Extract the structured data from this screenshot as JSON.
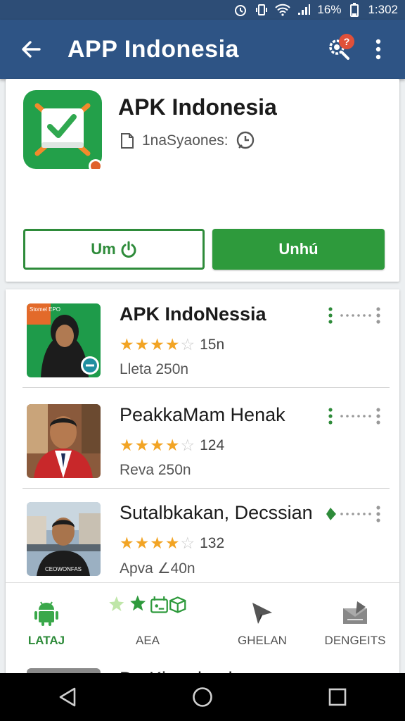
{
  "status_bar": {
    "battery_percent": "16%",
    "time": "1:302"
  },
  "app_bar": {
    "title": "APP Indonesia",
    "badge": "?"
  },
  "header": {
    "app_name": "APK Indonesia",
    "meta_text": "1naSyaones:",
    "button_outline_label": "Um",
    "button_filled_label": "Unhú"
  },
  "list": {
    "items": [
      {
        "name": "APK IndoNessia",
        "rating_value": 4,
        "rating_text": "15n",
        "subtitle": "Lleta 250n"
      },
      {
        "name": "PeakkaMam Henak",
        "rating_value": 4,
        "rating_text": "124",
        "subtitle": "Reva 250n"
      },
      {
        "name": "Sutalbkakan, Decssian",
        "rating_value": 4,
        "rating_text": "132",
        "subtitle": "Apva ∠40n"
      }
    ],
    "thumb1_text": "Stomel EPO",
    "thumb3_text": "CEOWONFAS"
  },
  "tabs": [
    {
      "label": "LATAJ",
      "icon": "android-icon",
      "active": true
    },
    {
      "label": "AEA",
      "icon": "stars-icons",
      "active": false
    },
    {
      "label": "GHELAN",
      "icon": "arrow-icon",
      "active": false
    },
    {
      "label": "DENGEITS",
      "icon": "tray-icon",
      "active": false
    }
  ],
  "peek_text": "Da Kja  a lu ala  u",
  "colors": {
    "appbar": "#2e5485",
    "accent_green": "#2e9a3c",
    "star": "#f2a424"
  }
}
